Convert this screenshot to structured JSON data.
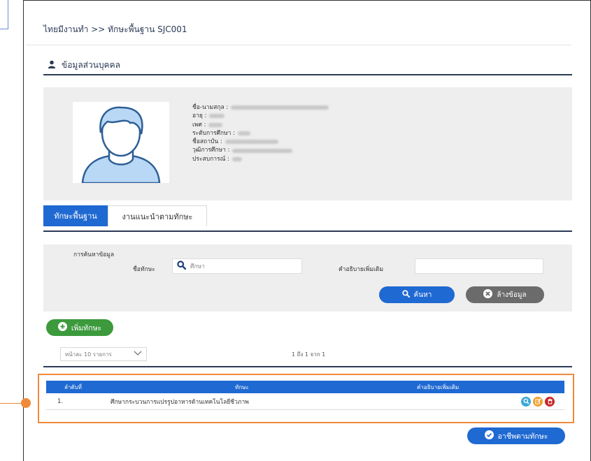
{
  "breadcrumb": "ไทยมีงานทำ >> ทักษะพื้นฐาน SJC001",
  "section": {
    "title": "ข้อมูลส่วนบุคคล"
  },
  "profile": {
    "fields": [
      {
        "label": "ชื่อ-นามสกุล :"
      },
      {
        "label": "อายุ :"
      },
      {
        "label": "เพศ :"
      },
      {
        "label": "ระดับการศึกษา :"
      },
      {
        "label": "ชื่อสถาบัน :"
      },
      {
        "label": "วุฒิการศึกษา :"
      },
      {
        "label": "ประสบการณ์ :"
      }
    ]
  },
  "tabs": [
    {
      "label": "ทักษะพื้นฐาน",
      "active": true
    },
    {
      "label": "งานแนะนำตามทักษะ",
      "active": false
    }
  ],
  "search": {
    "title": "การค้นหาข้อมูล",
    "skill_label": "ชื่อทักษะ",
    "skill_placeholder": "ศึกษา",
    "desc_label": "คำอธิบายเพิ่มเติม",
    "search_button": "ค้นหา",
    "clear_button": "ล้างข้อมูล"
  },
  "add_button": "เพิ่มทักษะ",
  "pagination": {
    "per_page": "หน้าละ 10 รายการ",
    "range": "1 ถึง 1 จาก 1"
  },
  "table": {
    "headers": {
      "no": "ลำดับที่",
      "skill": "ทักษะ",
      "desc": "คำอธิบายเพิ่มเติม"
    },
    "rows": [
      {
        "no": "1.",
        "skill": "ศึกษากระบวนการแปรรูปอาหารด้านเทคโนโลยีชีวภาพ",
        "desc": ""
      }
    ]
  },
  "career_button": "อาชีพตามทักษะ",
  "colors": {
    "primary": "#1f69d2",
    "navy": "#2b3a55",
    "green": "#3c9a3c",
    "gray_button": "#6b6b6b",
    "highlight": "#f08a3c"
  },
  "icons": [
    "user-icon",
    "avatar-icon",
    "search-icon",
    "close-circle-icon",
    "plus-circle-icon",
    "chevron-down-icon",
    "view-icon",
    "edit-icon",
    "delete-icon",
    "check-circle-icon"
  ]
}
